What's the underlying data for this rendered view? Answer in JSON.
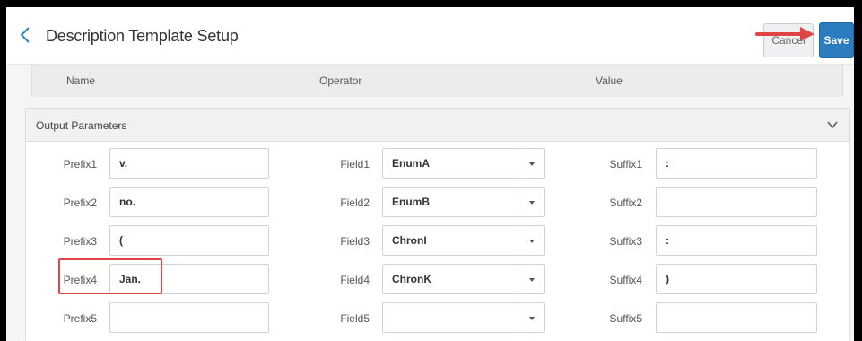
{
  "header": {
    "title": "Description Template Setup",
    "cancel_label": "Cancel",
    "save_label": "Save"
  },
  "rule_table": {
    "columns": [
      "Name",
      "Operator",
      "Value"
    ]
  },
  "output_parameters": {
    "title": "Output Parameters",
    "rows": [
      {
        "prefix_label": "Prefix1",
        "prefix_value": "v.",
        "field_label": "Field1",
        "field_value": "EnumA",
        "suffix_label": "Suffix1",
        "suffix_value": ":"
      },
      {
        "prefix_label": "Prefix2",
        "prefix_value": "no.",
        "field_label": "Field2",
        "field_value": "EnumB",
        "suffix_label": "Suffix2",
        "suffix_value": ""
      },
      {
        "prefix_label": "Prefix3",
        "prefix_value": "(",
        "field_label": "Field3",
        "field_value": "ChronI",
        "suffix_label": "Suffix3",
        "suffix_value": ":"
      },
      {
        "prefix_label": "Prefix4",
        "prefix_value": "Jan.",
        "field_label": "Field4",
        "field_value": "ChronK",
        "suffix_label": "Suffix4",
        "suffix_value": ")"
      },
      {
        "prefix_label": "Prefix5",
        "prefix_value": "",
        "field_label": "Field5",
        "field_value": "",
        "suffix_label": "Suffix5",
        "suffix_value": ""
      }
    ]
  },
  "colors": {
    "accent": "#2c7cc0",
    "annotation_red": "#e04545"
  },
  "icons": {
    "back": "chevron-left-icon",
    "collapse": "chevron-down-icon",
    "select": "caret-down-icon"
  }
}
